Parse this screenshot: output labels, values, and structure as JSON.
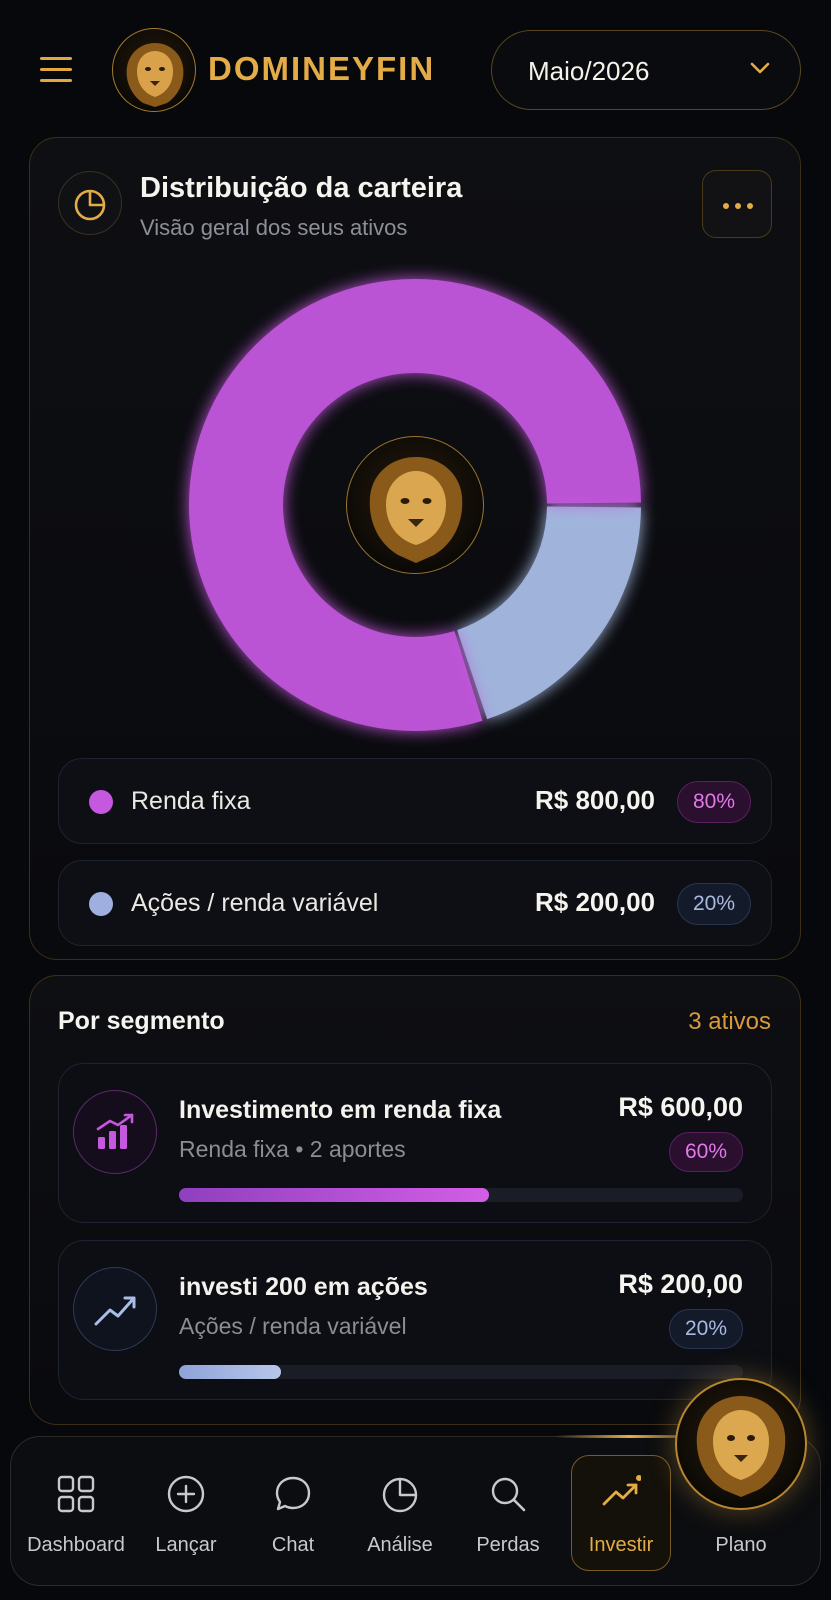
{
  "header": {
    "brand": "DOMINEYFIN",
    "month": "Maio/2026",
    "icons": [
      "menu-icon",
      "lion-logo",
      "chevron-down-icon"
    ]
  },
  "distribution": {
    "title": "Distribuição da carteira",
    "subtitle": "Visão geral dos seus ativos",
    "icons": [
      "pie-chart-icon",
      "more-horizontal-icon",
      "lion-logo"
    ]
  },
  "chart_data": {
    "type": "pie",
    "categories": [
      "Renda fixa",
      "Ações / renda variável"
    ],
    "values": [
      800,
      200
    ],
    "colors": [
      "#c558df",
      "#a9bde6"
    ],
    "donut": true
  },
  "legend": [
    {
      "name": "Renda fixa",
      "value": "R$ 800,00",
      "pct": "80%",
      "color": "#c558df"
    },
    {
      "name": "Ações / renda variável",
      "value": "R$ 200,00",
      "pct": "20%",
      "color": "#9fb0e0"
    }
  ],
  "segments": {
    "title": "Por segmento",
    "count": "3 ativos",
    "items": [
      {
        "title": "Investimento em renda fixa",
        "subtitle": "Renda fixa • 2 aportes",
        "value": "R$ 600,00",
        "pct": "60%",
        "progress": 0.55,
        "icon": "bar-chart-up-icon"
      },
      {
        "title": "investi 200 em ações",
        "subtitle": "Ações / renda variável",
        "value": "R$ 200,00",
        "pct": "20%",
        "progress": 0.18,
        "icon": "trending-up-icon"
      }
    ]
  },
  "nav": {
    "items": [
      {
        "label": "Dashboard",
        "icon": "grid-icon"
      },
      {
        "label": "Lançar",
        "icon": "plus-circle-icon"
      },
      {
        "label": "Chat",
        "icon": "chat-bubble-icon"
      },
      {
        "label": "Análise",
        "icon": "pie-chart-icon"
      },
      {
        "label": "Perdas",
        "icon": "search-icon"
      },
      {
        "label": "Investir",
        "icon": "trending-up-icon",
        "active": true
      },
      {
        "label": "Plano",
        "icon": "lion-logo"
      }
    ]
  }
}
